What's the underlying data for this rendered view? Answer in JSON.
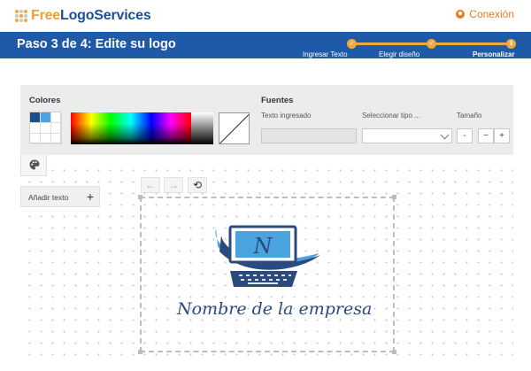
{
  "header": {
    "brand_free": "Free",
    "brand_rest": "LogoServices",
    "login_label": "Conexión"
  },
  "steps": {
    "title": "Paso 3 de 4: Edite su logo",
    "items": [
      {
        "label": "Ingresar Texto",
        "state": "done"
      },
      {
        "label": "Elegir diseño",
        "state": "done"
      },
      {
        "label": "Personalizar",
        "state": "current",
        "number": "3"
      }
    ]
  },
  "colors_panel": {
    "heading": "Colores",
    "selected_swatches": [
      "#1e4d8c",
      "#4aa3df"
    ]
  },
  "fonts_panel": {
    "heading": "Fuentes",
    "text_input_label": "Texto ingresado",
    "text_input_value": "",
    "font_type_label": "Seleccionar tipo ...",
    "font_type_value": "",
    "size_label": "Tamaño",
    "size_minus": "-",
    "size_minus2": "−",
    "size_plus": "+"
  },
  "sidebar": {
    "add_text_label": "Añadir texto",
    "add_text_plus": "+"
  },
  "toolbar": {
    "undo_icon": "arrow-left-icon",
    "redo_icon": "arrow-right-icon",
    "reset_icon": "rotate-icon"
  },
  "logo": {
    "monitor_letter": "N",
    "company_name": "Nombre de la empresa",
    "colors": {
      "dark": "#2b4a7d",
      "light": "#4aa3df"
    }
  },
  "colors": {
    "brand_blue": "#1e5aa8",
    "accent_orange": "#f2a93b"
  }
}
